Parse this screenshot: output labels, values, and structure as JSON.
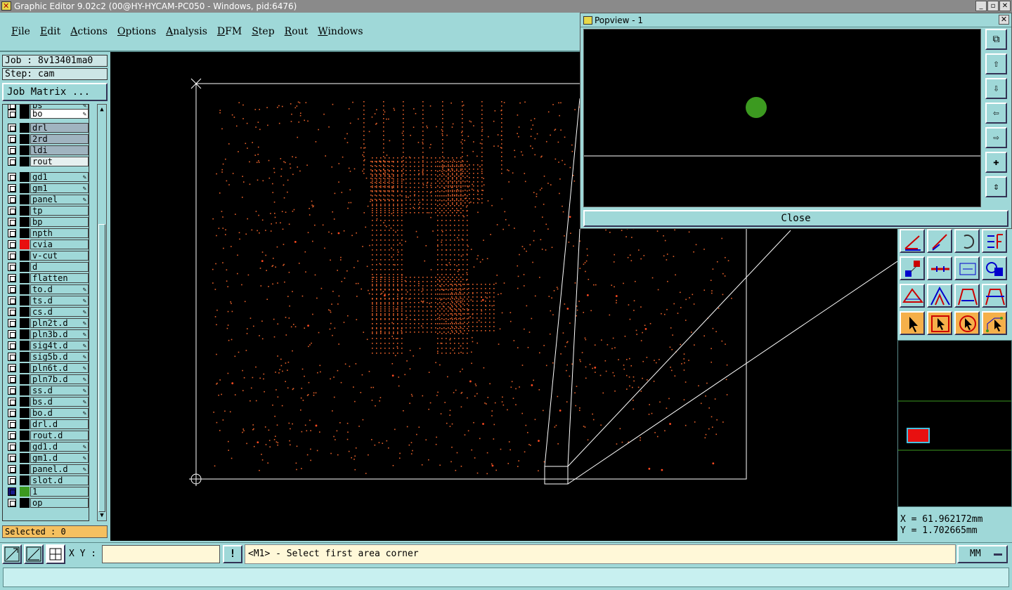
{
  "window": {
    "title": "Graphic Editor 9.02c2 (00@HY-HYCAM-PC050 - Windows, pid:6476)",
    "controls": [
      "_",
      "▫",
      "✕"
    ]
  },
  "menu": [
    "File",
    "Edit",
    "Actions",
    "Options",
    "Analysis",
    "DFM",
    "Step",
    "Rout",
    "Windows"
  ],
  "job": "Job : 8v13401ma0",
  "step": "Step: cam",
  "job_matrix_label": "Job Matrix ...",
  "layers": [
    {
      "name": "bs",
      "color": "#000000",
      "style": "partial",
      "edit": true
    },
    {
      "name": "bo",
      "color": "#000000",
      "style": "sel",
      "edit": true
    },
    {
      "name": "drl",
      "color": "#000000",
      "style": "gray",
      "edit": false
    },
    {
      "name": "2rd",
      "color": "#000000",
      "style": "gray",
      "edit": false
    },
    {
      "name": "ldi",
      "color": "#000000",
      "style": "gray",
      "edit": false
    },
    {
      "name": "rout",
      "color": "#000000",
      "style": "light",
      "edit": false
    },
    {
      "name": "gd1",
      "color": "#000000",
      "style": "normal",
      "edit": true
    },
    {
      "name": "gm1",
      "color": "#000000",
      "style": "normal",
      "edit": true
    },
    {
      "name": "panel",
      "color": "#000000",
      "style": "normal",
      "edit": true
    },
    {
      "name": "tp",
      "color": "#000000",
      "style": "normal",
      "edit": false
    },
    {
      "name": "bp",
      "color": "#000000",
      "style": "normal",
      "edit": false
    },
    {
      "name": "npth",
      "color": "#000000",
      "style": "normal",
      "edit": false
    },
    {
      "name": "cvia",
      "color": "#e81010",
      "style": "normal",
      "edit": false
    },
    {
      "name": "v-cut",
      "color": "#000000",
      "style": "normal",
      "edit": false
    },
    {
      "name": "d",
      "color": "#000000",
      "style": "normal",
      "edit": false
    },
    {
      "name": "flatten",
      "color": "#000000",
      "style": "normal",
      "edit": false
    },
    {
      "name": "to.d",
      "color": "#000000",
      "style": "normal",
      "edit": true
    },
    {
      "name": "ts.d",
      "color": "#000000",
      "style": "normal",
      "edit": true
    },
    {
      "name": "cs.d",
      "color": "#000000",
      "style": "normal",
      "edit": true
    },
    {
      "name": "pln2t.d",
      "color": "#000000",
      "style": "normal",
      "edit": true
    },
    {
      "name": "pln3b.d",
      "color": "#000000",
      "style": "normal",
      "edit": true
    },
    {
      "name": "sig4t.d",
      "color": "#000000",
      "style": "normal",
      "edit": true
    },
    {
      "name": "sig5b.d",
      "color": "#000000",
      "style": "normal",
      "edit": true
    },
    {
      "name": "pln6t.d",
      "color": "#000000",
      "style": "normal",
      "edit": true
    },
    {
      "name": "pln7b.d",
      "color": "#000000",
      "style": "normal",
      "edit": true
    },
    {
      "name": "ss.d",
      "color": "#000000",
      "style": "normal",
      "edit": true
    },
    {
      "name": "bs.d",
      "color": "#000000",
      "style": "normal",
      "edit": true
    },
    {
      "name": "bo.d",
      "color": "#000000",
      "style": "normal",
      "edit": true
    },
    {
      "name": "drl.d",
      "color": "#000000",
      "style": "normal",
      "edit": false
    },
    {
      "name": "rout.d",
      "color": "#000000",
      "style": "normal",
      "edit": false
    },
    {
      "name": "gd1.d",
      "color": "#000000",
      "style": "normal",
      "edit": true
    },
    {
      "name": "gm1.d",
      "color": "#000000",
      "style": "normal",
      "edit": true
    },
    {
      "name": "panel.d",
      "color": "#000000",
      "style": "normal",
      "edit": true
    },
    {
      "name": "slot.d",
      "color": "#000000",
      "style": "normal",
      "edit": false
    },
    {
      "name": "1",
      "color": "#3c9a20",
      "style": "normal",
      "edit": false,
      "work": true
    },
    {
      "name": "op",
      "color": "#000000",
      "style": "normal",
      "edit": false
    }
  ],
  "selected": "Selected : 0",
  "popview": {
    "title": "Popview - 1",
    "close_label": "Close"
  },
  "coords": {
    "x": "X = 61.962172mm",
    "y": "Y = 1.702665mm"
  },
  "xy_label": "X Y :",
  "xy_value": "",
  "prompt": "<M1> - Select first area corner",
  "units": "MM",
  "colors": {
    "panel_bg": "#9fd8d8",
    "canvas_bg": "#000000",
    "drill_dot": "#e8622a",
    "pad_green": "#3c9a20",
    "selected_bg": "#f5c060"
  }
}
